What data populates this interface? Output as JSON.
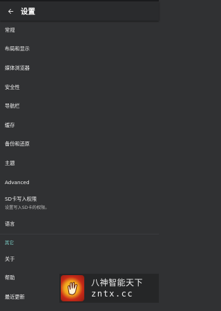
{
  "appbar": {
    "title": "设置",
    "back_icon": "arrow-left-icon"
  },
  "items_top": [
    {
      "label": "常规"
    },
    {
      "label": "布局和显示"
    },
    {
      "label": "媒体浏览器"
    },
    {
      "label": "安全性"
    },
    {
      "label": "导航栏"
    },
    {
      "label": "缓存"
    },
    {
      "label": "备份和还原"
    },
    {
      "label": "主题"
    },
    {
      "label": "Advanced"
    }
  ],
  "sd_item": {
    "label": "SD卡写入权限",
    "summary": "设置写入SD卡的权限。"
  },
  "language_item": {
    "label": "语言"
  },
  "section_other": {
    "title": "其它"
  },
  "items_other": [
    {
      "label": "关于"
    },
    {
      "label": "帮助"
    },
    {
      "label": "最近更新"
    }
  ],
  "watermark": {
    "line1": "八神智能天下",
    "line2": "zntx.cc"
  },
  "colors": {
    "background": "#303133",
    "appbar": "#2a2b2d",
    "section_accent": "#7dd3cb"
  }
}
